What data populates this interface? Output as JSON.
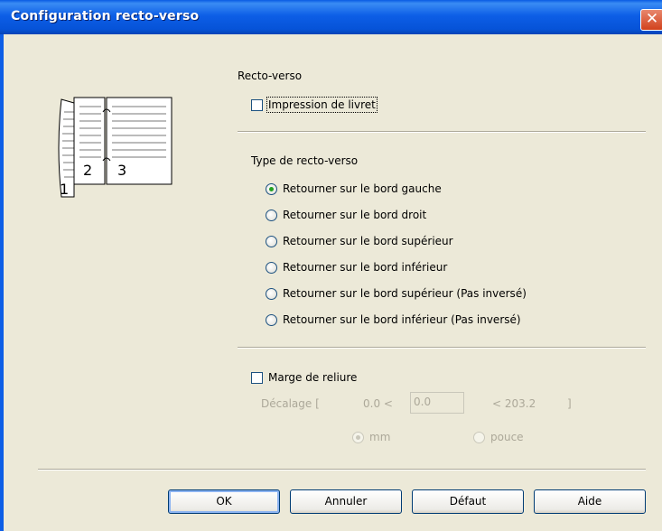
{
  "window": {
    "title": "Configuration  recto-verso",
    "close_glyph": "✕"
  },
  "duplex": {
    "group_label": "Recto-verso",
    "booklet_label": "Impression de livret",
    "type_label": "Type de recto-verso",
    "options": [
      {
        "label": "Retourner sur le bord gauche",
        "checked": true
      },
      {
        "label": "Retourner sur le bord droit",
        "checked": false
      },
      {
        "label": "Retourner sur le bord supérieur",
        "checked": false
      },
      {
        "label": "Retourner sur le bord inférieur",
        "checked": false
      },
      {
        "label": "Retourner sur le bord supérieur (Pas inversé)",
        "checked": false
      },
      {
        "label": "Retourner sur le bord inférieur (Pas inversé)",
        "checked": false
      }
    ]
  },
  "binding": {
    "label": "Marge de reliure",
    "offset_label": "Décalage [",
    "min": "0.0 <",
    "value": "0.0",
    "max": "<   203.2",
    "close_bracket": "]",
    "unit_mm": "mm",
    "unit_inch": "pouce"
  },
  "illustration": {
    "page_numbers": [
      "1",
      "2",
      "3"
    ]
  },
  "buttons": {
    "ok": "OK",
    "cancel": "Annuler",
    "default": "Défaut",
    "help": "Aide"
  }
}
